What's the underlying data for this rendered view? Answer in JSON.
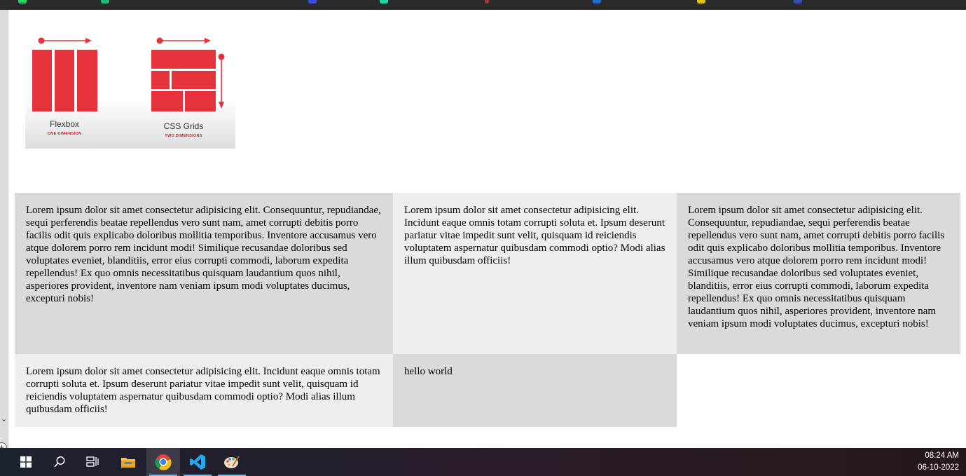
{
  "hero_image": {
    "left_caption": "Flexbox",
    "left_subcaption": "ONE DIMENSION",
    "right_caption": "CSS Grids",
    "right_subcaption": "TWO DIMENSIONS",
    "accent_color": "#e6323a"
  },
  "grid": {
    "cells": [
      {
        "text": "Lorem ipsum dolor sit amet consectetur adipisicing elit. Consequuntur, repudiandae, sequi perferendis beatae repellendus vero sunt nam, amet corrupti debitis porro facilis odit quis explicabo doloribus mollitia temporibus. Inventore accusamus vero atque dolorem porro rem incidunt modi! Similique recusandae doloribus sed voluptates eveniet, blanditiis, error eius corrupti commodi, laborum expedita repellendus! Ex quo omnis necessitatibus quisquam laudantium quos nihil, asperiores provident, inventore nam veniam ipsum modi voluptates ducimus, excepturi nobis!"
      },
      {
        "text": "Lorem ipsum dolor sit amet consectetur adipisicing elit. Incidunt eaque omnis totam corrupti soluta et. Ipsum deserunt pariatur vitae impedit sunt velit, quisquam id reiciendis voluptatem aspernatur quibusdam commodi optio? Modi alias illum quibusdam officiis!"
      },
      {
        "text": "Lorem ipsum dolor sit amet consectetur adipisicing elit. Consequuntur, repudiandae, sequi perferendis beatae repellendus vero sunt nam, amet corrupti debitis porro facilis odit quis explicabo doloribus mollitia temporibus. Inventore accusamus vero atque dolorem porro rem incidunt modi! Similique recusandae doloribus sed voluptates eveniet, blanditiis, error eius corrupti commodi, laborum expedita repellendus! Ex quo omnis necessitatibus quisquam laudantium quos nihil, asperiores provident, inventore nam veniam ipsum modi voluptates ducimus, excepturi nobis!"
      },
      {
        "text": "Lorem ipsum dolor sit amet consectetur adipisicing elit. Incidunt eaque omnis totam corrupti soluta et. Ipsum deserunt pariatur vitae impedit sunt velit, quisquam id reiciendis voluptatem aspernatur quibusdam commodi optio? Modi alias illum quibusdam officiis!"
      },
      {
        "text": "hello world"
      }
    ],
    "colors": {
      "dark_cell": "#dadada",
      "light_cell": "#eeeeee"
    }
  },
  "taskbar": {
    "items": [
      {
        "icon": "windows-start-icon"
      },
      {
        "icon": "search-icon"
      },
      {
        "icon": "task-view-icon"
      },
      {
        "icon": "file-explorer-icon"
      },
      {
        "icon": "chrome-icon"
      },
      {
        "icon": "vscode-icon"
      },
      {
        "icon": "paint-icon"
      }
    ],
    "time": "08:24 AM",
    "date": "06-10-2022"
  }
}
